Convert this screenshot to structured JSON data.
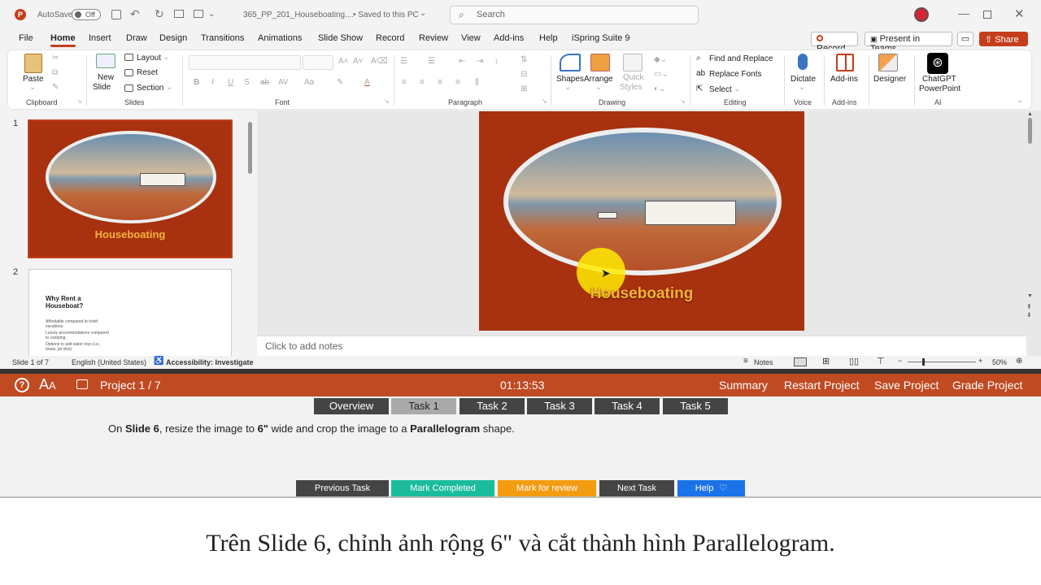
{
  "titlebar": {
    "autosave_label": "AutoSave",
    "autosave_state": "Off",
    "filename": "365_PP_201_Houseboating....",
    "save_status": "• Saved to this PC",
    "search_placeholder": "Search"
  },
  "menu": {
    "items": [
      "File",
      "Home",
      "Insert",
      "Draw",
      "Design",
      "Transitions",
      "Animations",
      "Slide Show",
      "Record",
      "Review",
      "View",
      "Add-ins",
      "Help",
      "iSpring Suite 9"
    ],
    "active": "Home",
    "record_button": "Record",
    "teams_button": "Present in Teams",
    "share_button": "Share"
  },
  "ribbon": {
    "clipboard": {
      "paste": "Paste",
      "group": "Clipboard"
    },
    "slides": {
      "new_slide_1": "New",
      "new_slide_2": "Slide",
      "layout": "Layout",
      "reset": "Reset",
      "section": "Section",
      "group": "Slides"
    },
    "font": {
      "group": "Font"
    },
    "paragraph": {
      "group": "Paragraph"
    },
    "drawing": {
      "shapes": "Shapes",
      "arrange": "Arrange",
      "quick_styles_1": "Quick",
      "quick_styles_2": "Styles",
      "group": "Drawing"
    },
    "editing": {
      "find": "Find and Replace",
      "replace_fonts": "Replace Fonts",
      "select": "Select",
      "group": "Editing"
    },
    "voice": {
      "dictate": "Dictate",
      "group": "Voice"
    },
    "addins": {
      "addins": "Add-ins",
      "group": "Add-ins"
    },
    "designer": {
      "label": "Designer"
    },
    "ai": {
      "chatgpt_1": "ChatGPT",
      "chatgpt_2": "PowerPoint",
      "group": "AI"
    }
  },
  "thumbnails": {
    "slide1_num": "1",
    "slide1_title": "Houseboating",
    "slide2_num": "2",
    "slide2_title_1": "Why Rent a",
    "slide2_title_2": "Houseboat?",
    "slide2_bullets": [
      "Affordable compared to hotel vacations.",
      "Luxury accommodations compared to camping.",
      "Options to add water toys (i.e., boats, jet skis)."
    ]
  },
  "slide": {
    "title": "Houseboating"
  },
  "notes_placeholder": "Click to add notes",
  "statusbar": {
    "slide_count": "Slide 1 of 7",
    "language": "English (United States)",
    "accessibility": "Accessibility: Investigate",
    "notes": "Notes",
    "zoom": "50%"
  },
  "project_bar": {
    "project": "Project 1 / 7",
    "timer": "01:13:53",
    "summary": "Summary",
    "restart": "Restart Project",
    "save": "Save Project",
    "grade": "Grade Project"
  },
  "task_tabs": [
    "Overview",
    "Task 1",
    "Task 2",
    "Task 3",
    "Task 4",
    "Task 5"
  ],
  "selected_tab": "Task 1",
  "instruction": {
    "p1": "On ",
    "b1": "Slide 6",
    "p2": ", resize the image to ",
    "b2": "6\"",
    "p3": " wide and crop the image to a ",
    "b3": "Parallelogram",
    "p4": " shape."
  },
  "actions": {
    "previous": "Previous Task",
    "complete": "Mark Completed",
    "review": "Mark for review",
    "next": "Next Task",
    "help": "Help"
  },
  "caption": "Trên Slide 6, chỉnh ảnh rộng 6\" và cắt thành hình Parallelogram.",
  "colors": {
    "accent": "#c43e1c",
    "slide_bg": "#a8310f",
    "title_gold": "#f0b43a",
    "complete": "#1bbc9b",
    "review": "#f39c12",
    "help": "#1a73e8"
  }
}
